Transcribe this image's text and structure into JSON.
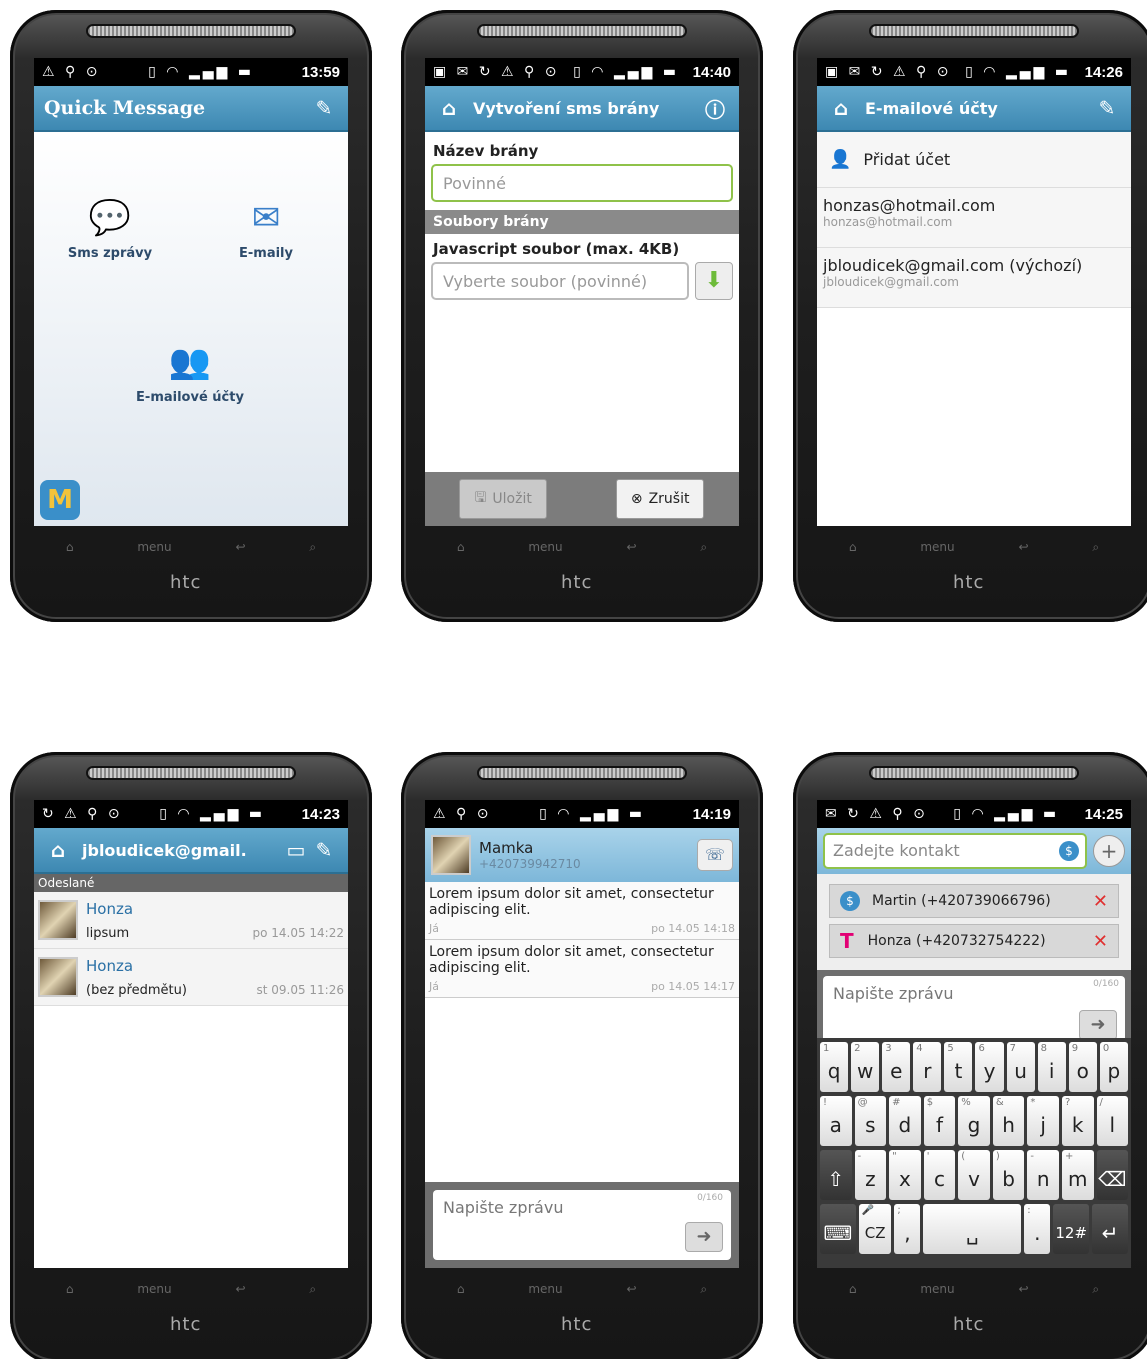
{
  "device": {
    "brand": "htc",
    "menu_label": "menu"
  },
  "screen1": {
    "time": "13:59",
    "title": "Quick Message",
    "items": [
      {
        "label": "Sms zprávy"
      },
      {
        "label": "E-maily"
      },
      {
        "label": "E-mailové účty"
      }
    ]
  },
  "screen2": {
    "time": "14:40",
    "title": "Vytvoření sms brány",
    "name_label": "Název brány",
    "name_placeholder": "Povinné",
    "section": "Soubory brány",
    "js_label": "Javascript soubor (max. 4KB)",
    "js_placeholder": "Vyberte soubor (povinné)",
    "save": "Uložit",
    "cancel": "Zrušit"
  },
  "screen3": {
    "time": "14:26",
    "title": "E-mailové účty",
    "add": "Přidat účet",
    "accounts": [
      {
        "title": "honzas@hotmail.com",
        "sub": "honzas@hotmail.com"
      },
      {
        "title": "jbloudicek@gmail.com (výchozí)",
        "sub": "jbloudicek@gmail.com"
      }
    ]
  },
  "screen4": {
    "time": "14:23",
    "title": "jbloudicek@gmail.",
    "folder": "Odeslané",
    "mails": [
      {
        "name": "Honza",
        "subject": "lipsum",
        "date": "po 14.05 14:22"
      },
      {
        "name": "Honza",
        "subject": "(bez předmětu)",
        "date": "st 09.05 11:26"
      }
    ]
  },
  "screen5": {
    "time": "14:19",
    "contact": "Mamka",
    "number": "+420739942710",
    "messages": [
      {
        "text": "Lorem ipsum dolor sit amet, consectetur adipiscing elit.",
        "from": "Já",
        "date": "po 14.05 14:18"
      },
      {
        "text": "Lorem ipsum dolor sit amet, consectetur adipiscing elit.",
        "from": "Já",
        "date": "po 14.05 14:17"
      }
    ],
    "placeholder": "Napište zprávu",
    "counter": "0/160"
  },
  "screen6": {
    "time": "14:25",
    "contact_placeholder": "Zadejte kontakt",
    "recipients": [
      {
        "label": "Martin (+420739066796)"
      },
      {
        "label": "Honza (+420732754222)"
      }
    ],
    "placeholder": "Napište zprávu",
    "counter": "0/160",
    "keys_row1": [
      "q",
      "w",
      "e",
      "r",
      "t",
      "y",
      "u",
      "i",
      "o",
      "p"
    ],
    "nums_row1": [
      "1",
      "2",
      "3",
      "4",
      "5",
      "6",
      "7",
      "8",
      "9",
      "0"
    ],
    "keys_row2": [
      "a",
      "s",
      "d",
      "f",
      "g",
      "h",
      "j",
      "k",
      "l"
    ],
    "sym_row2": [
      "!",
      "@",
      "#",
      "$",
      "%",
      "&",
      "*",
      "?",
      "/"
    ],
    "keys_row3": [
      "z",
      "x",
      "c",
      "v",
      "b",
      "n",
      "m"
    ],
    "sym_row3": [
      "-",
      "\"",
      "'",
      "(",
      ")",
      "-",
      "+"
    ],
    "lang": "CZ",
    "num_key": "12#"
  }
}
